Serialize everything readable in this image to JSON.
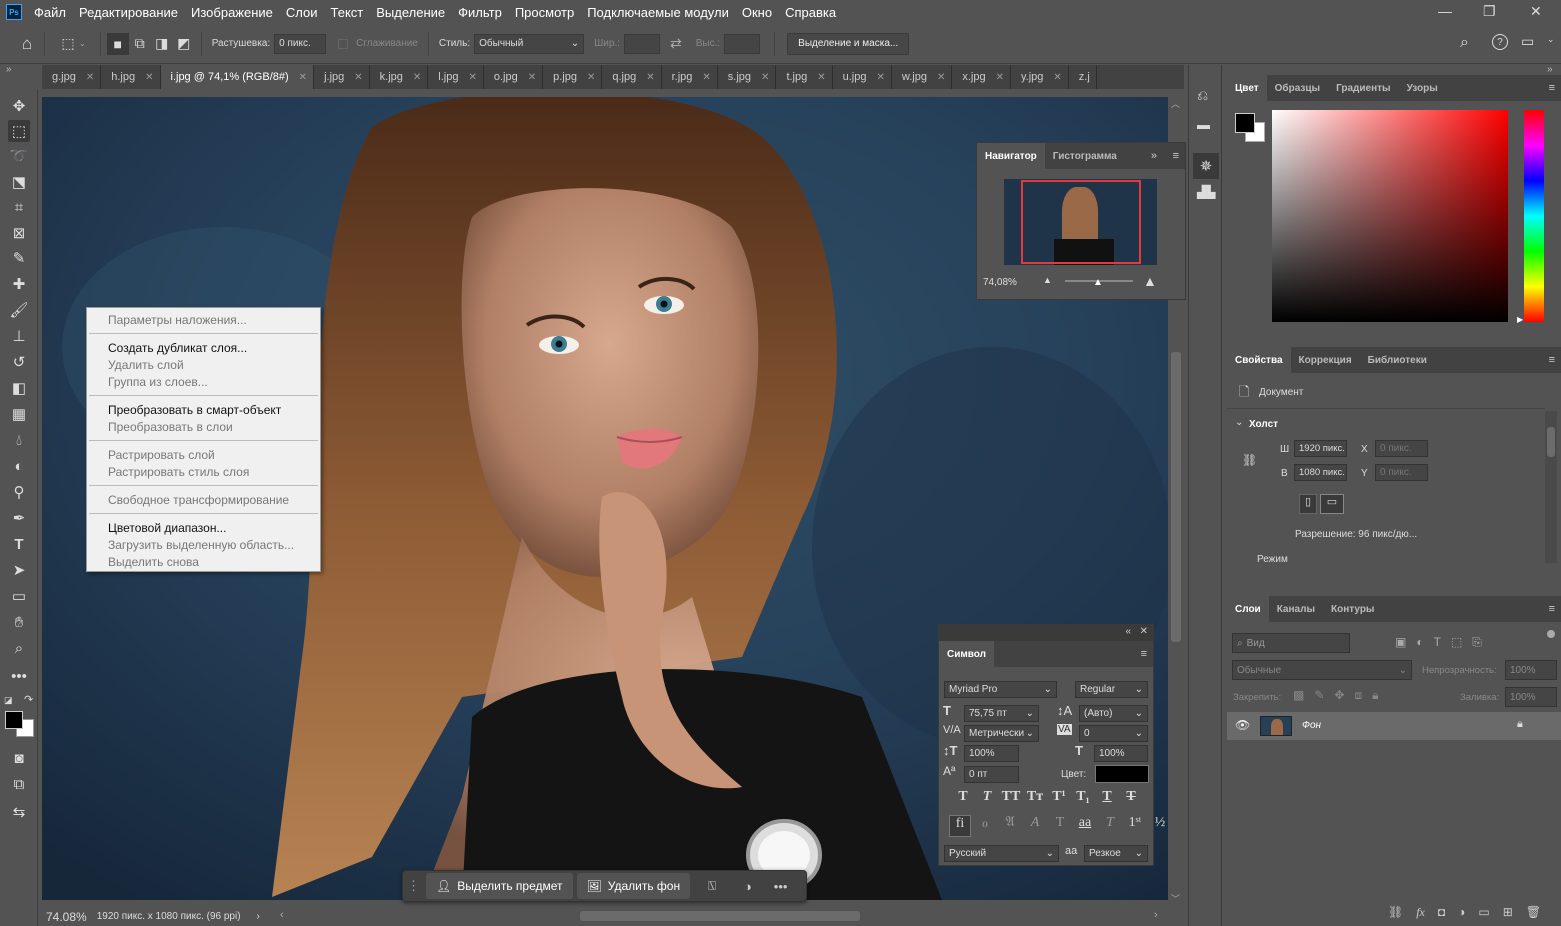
{
  "app": {
    "logo": "Ps"
  },
  "menu": [
    "Файл",
    "Редактирование",
    "Изображение",
    "Слои",
    "Текст",
    "Выделение",
    "Фильтр",
    "Просмотр",
    "Подключаемые модули",
    "Окно",
    "Справка"
  ],
  "options": {
    "feather_label": "Растушевка:",
    "feather_value": "0 пикс.",
    "antialias_label": "Сглаживание",
    "style_label": "Стиль:",
    "style_value": "Обычный",
    "width_label": "Шир.:",
    "height_label": "Выс.:",
    "mask_button": "Выделение и маска..."
  },
  "tabs": [
    {
      "label": "g.jpg"
    },
    {
      "label": "h.jpg"
    },
    {
      "label": "i.jpg @ 74,1% (RGB/8#)",
      "active": true
    },
    {
      "label": "j.jpg"
    },
    {
      "label": "k.jpg"
    },
    {
      "label": "l.jpg"
    },
    {
      "label": "o.jpg"
    },
    {
      "label": "p.jpg"
    },
    {
      "label": "q.jpg"
    },
    {
      "label": "r.jpg"
    },
    {
      "label": "s.jpg"
    },
    {
      "label": "t.jpg"
    },
    {
      "label": "u.jpg"
    },
    {
      "label": "w.jpg"
    },
    {
      "label": "x.jpg"
    },
    {
      "label": "y.jpg"
    },
    {
      "label": "z.j"
    }
  ],
  "context_menu": [
    {
      "label": "Параметры наложения...",
      "disabled": true
    },
    {
      "divider": true
    },
    {
      "label": "Создать дубликат слоя...",
      "disabled": false
    },
    {
      "label": "Удалить слой",
      "disabled": true
    },
    {
      "label": "Группа из слоев...",
      "disabled": true
    },
    {
      "divider": true
    },
    {
      "label": "Преобразовать в смарт-объект",
      "disabled": false
    },
    {
      "label": "Преобразовать в слои",
      "disabled": true
    },
    {
      "divider": true
    },
    {
      "label": "Растрировать слой",
      "disabled": true
    },
    {
      "label": "Растрировать стиль слоя",
      "disabled": true
    },
    {
      "divider": true
    },
    {
      "label": "Свободное трансформирование",
      "disabled": true
    },
    {
      "divider": true
    },
    {
      "label": "Цветовой диапазон...",
      "disabled": false
    },
    {
      "label": "Загрузить выделенную область...",
      "disabled": true
    },
    {
      "label": "Выделить снова",
      "disabled": true
    }
  ],
  "navigator": {
    "tab1": "Навигатор",
    "tab2": "Гистограмма",
    "zoom": "74,08%"
  },
  "symbol": {
    "title": "Символ",
    "font": "Myriad Pro",
    "style": "Regular",
    "size": "75,75 пт",
    "leading": "(Авто)",
    "kerning": "Метрически",
    "tracking": "0",
    "vscale": "100%",
    "hscale": "100%",
    "baseline": "0 пт",
    "color_label": "Цвет:",
    "language": "Русский",
    "aa_label": "aa",
    "aa": "Резкое"
  },
  "color_panel": {
    "tabs": [
      "Цвет",
      "Образцы",
      "Градиенты",
      "Узоры"
    ],
    "fg": "#000000",
    "bg": "#ffffff"
  },
  "properties": {
    "tabs": [
      "Свойства",
      "Коррекция",
      "Библиотеки"
    ],
    "doc": "Документ",
    "section": "Холст",
    "w_label": "Ш",
    "w": "1920 пикс.",
    "h_label": "В",
    "h": "1080 пикс.",
    "x_label": "X",
    "y_label": "Y",
    "x_ph": "0 пикс.",
    "y_ph": "0 пикс.",
    "resolution": "Разрешение: 96 пикс/дю...",
    "mode": "Режим"
  },
  "layers": {
    "tabs": [
      "Слои",
      "Каналы",
      "Контуры"
    ],
    "search": "Вид",
    "blend": "Обычные",
    "opacity_label": "Непрозрачность:",
    "opacity": "100%",
    "lock_label": "Закрепить:",
    "fill_label": "Заливка:",
    "fill": "100%",
    "layer_name": "Фон"
  },
  "status": {
    "zoom": "74.08%",
    "info": "1920 пикс. x 1080 пикс. (96 ppi)"
  },
  "task": {
    "select_subject": "Выделить предмет",
    "remove_bg": "Удалить фон"
  }
}
